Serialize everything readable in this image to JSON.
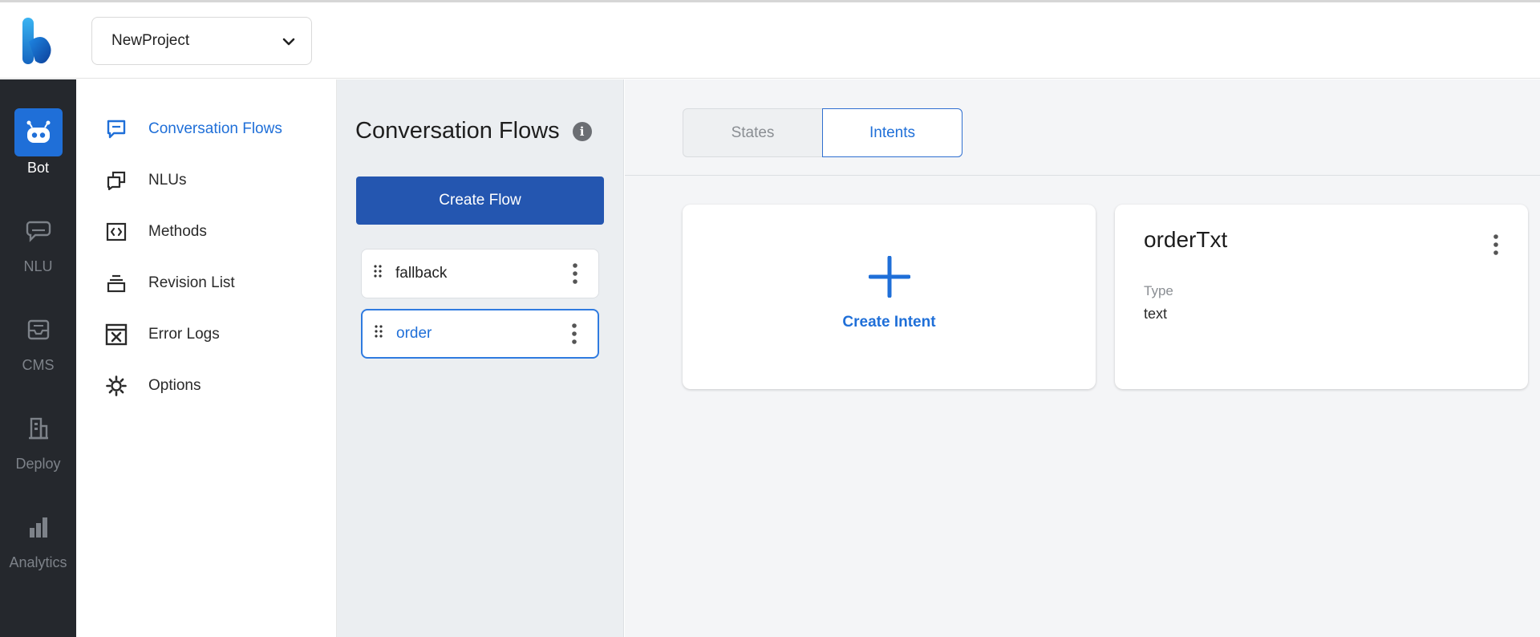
{
  "header": {
    "logo_icon": "app-logo-icon",
    "project": {
      "selected": "NewProject",
      "icon": "chevron-down-icon"
    }
  },
  "rail": {
    "items": [
      {
        "label": "Bot",
        "icon": "robot-icon",
        "active": true
      },
      {
        "label": "NLU",
        "icon": "chat-bubble-icon",
        "active": false
      },
      {
        "label": "CMS",
        "icon": "inbox-icon",
        "active": false
      },
      {
        "label": "Deploy",
        "icon": "building-icon",
        "active": false
      },
      {
        "label": "Analytics",
        "icon": "bar-chart-icon",
        "active": false
      }
    ]
  },
  "subnav": {
    "items": [
      {
        "label": "Conversation Flows",
        "icon": "message-square-icon",
        "active": true
      },
      {
        "label": "NLUs",
        "icon": "stacked-messages-icon",
        "active": false
      },
      {
        "label": "Methods",
        "icon": "code-box-icon",
        "active": false
      },
      {
        "label": "Revision List",
        "icon": "layers-icon",
        "active": false
      },
      {
        "label": "Error Logs",
        "icon": "error-window-icon",
        "active": false
      },
      {
        "label": "Options",
        "icon": "gear-icon",
        "active": false
      }
    ]
  },
  "flows": {
    "title": "Conversation Flows",
    "info_glyph": "i",
    "create_label": "Create Flow",
    "items": [
      {
        "name": "fallback",
        "selected": false
      },
      {
        "name": "order",
        "selected": true
      }
    ]
  },
  "main": {
    "tabs": [
      {
        "label": "States",
        "active": false
      },
      {
        "label": "Intents",
        "active": true
      }
    ],
    "create_intent_label": "Create Intent",
    "intents": [
      {
        "name": "orderTxt",
        "type_label": "Type",
        "type_value": "text"
      }
    ]
  },
  "colors": {
    "accent": "#1f6fd8",
    "primary_button": "#2456b0",
    "rail_bg": "#25282d",
    "flows_bg": "#ebeef1",
    "main_bg": "#f4f5f7"
  }
}
